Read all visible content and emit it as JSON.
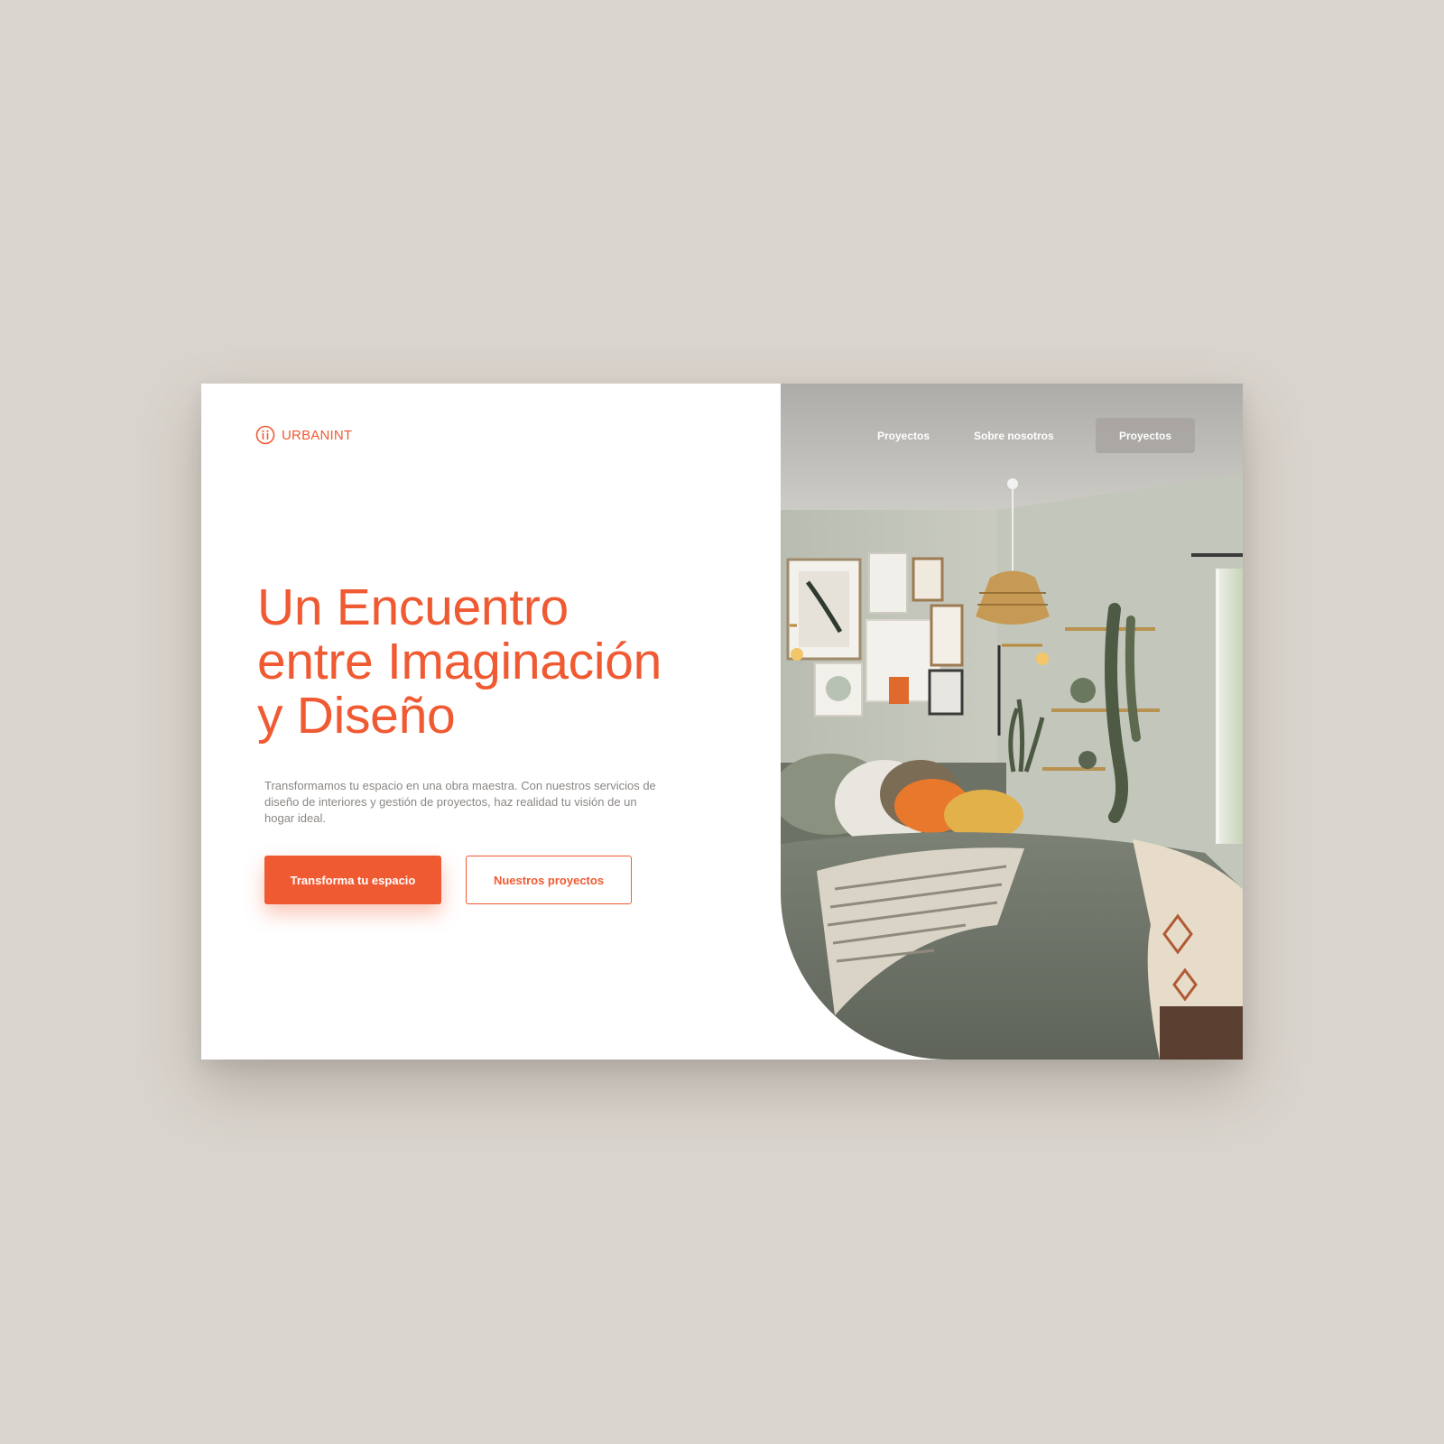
{
  "brand": {
    "name": "URBANINT",
    "icon": "circle-ii-logo-icon",
    "accent": "#f05a32"
  },
  "nav": {
    "links": [
      {
        "label": "Proyectos"
      },
      {
        "label": "Sobre nosotros"
      }
    ],
    "cta_label": "Proyectos"
  },
  "hero": {
    "headline_lines": [
      "Un Encuentro",
      "entre Imaginación",
      "y Diseño"
    ],
    "description": "Transformamos tu espacio en una obra maestra. Con nuestros servicios de diseño de interiores y gestión de proyectos, haz realidad tu visión de un hogar ideal.",
    "primary_button": "Transforma tu espacio",
    "secondary_button": "Nuestros proyectos",
    "image": "bedroom-interior-photo"
  },
  "colors": {
    "background": "#d9d4cd",
    "card": "#ffffff",
    "accent": "#f05a32",
    "body_text": "#8b8784"
  }
}
